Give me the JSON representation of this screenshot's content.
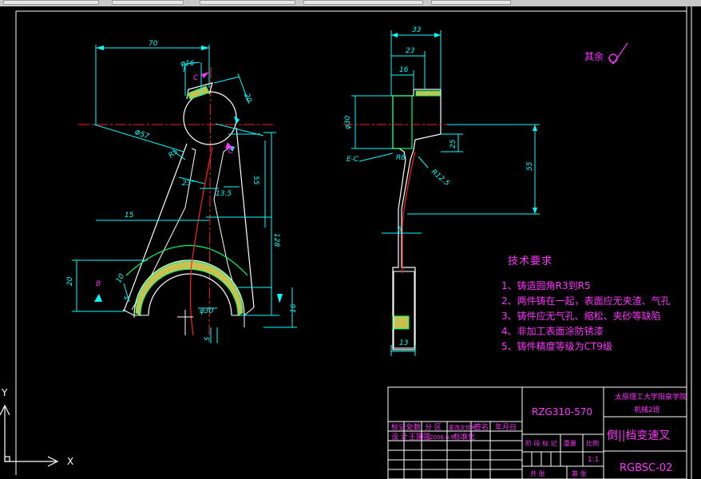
{
  "dims": {
    "d70": "70",
    "d16": "φ16",
    "c1": "C",
    "d20a": "20",
    "d57": "Φ57",
    "d15a": "R5",
    "c2": "C",
    "d55a": "55",
    "d23": "23°",
    "d135": "13.5",
    "d15": "15",
    "d128": "128",
    "d20b": "20",
    "db": "B",
    "d10": "10",
    "d30": "φ30",
    "d16b": "16",
    "d5": "5",
    "d5b": "5",
    "d33": "33",
    "d23b": "23",
    "d16c": "16",
    "d30b": "φ30",
    "d25": "25",
    "d55b": "55",
    "ec": "E-C",
    "r8": "R8",
    "r12": "R12.5",
    "d8": "8",
    "d13": "13"
  },
  "roughness": "其余",
  "tech": {
    "title": "技术要求",
    "items": [
      "1、铸造圆角R3到R5",
      "2、两件铸在一起，表面应无夹渣、气孔",
      "3、铸件应无气孔、缩松、夹砂等缺陷",
      "4、非加工表面涂防锈漆",
      "5、铸件精度等级为CT9级"
    ]
  },
  "titleblock": {
    "code": "RZG310-570",
    "school": "太原理工大学阳泉学院",
    "dept": "机械2班",
    "name": "倒||档变速叉",
    "drawing_no": "RGBSC-02",
    "scale": "1:1",
    "date": "2006.6.6",
    "row1": [
      "标记",
      "处数",
      "分 区",
      "更改文件号",
      "签名",
      "年月日"
    ],
    "row2": [
      "设 计",
      "王国强",
      "2006.6.6",
      "标准化"
    ],
    "row3": [
      "阶 段 标 记",
      "重量",
      "比例"
    ],
    "row4": [
      "共 张",
      "第 张"
    ]
  },
  "ucs": {
    "x": "X",
    "y": "Y"
  }
}
